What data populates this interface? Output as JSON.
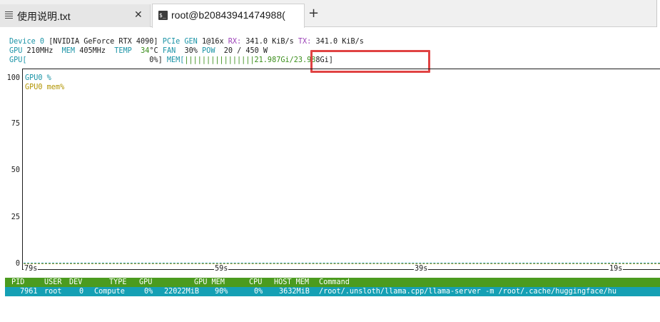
{
  "tabs": [
    {
      "label": "使用说明.txt",
      "close": "✕"
    },
    {
      "label": "root@b20843941474988(",
      "close": ""
    }
  ],
  "new_tab": "+",
  "terminal": {
    "device_line": {
      "device": "Device 0",
      "name": "[NVIDIA GeForce RTX 4090]",
      "pcie_label": "PCIe",
      "gen_label": "GEN",
      "gen_value": "1@16x",
      "rx_label": "RX:",
      "rx_value": "341.0 KiB/s",
      "tx_label": "TX:",
      "tx_value": "341.0 KiB/s"
    },
    "stats_line": {
      "gpu_label": "GPU",
      "gpu_clock": "210MHz",
      "mem_label": "MEM",
      "mem_clock": "405MHz",
      "temp_label": "TEMP",
      "temp_value": "34",
      "temp_unit": "°C",
      "fan_label": "FAN",
      "fan_value": "30%",
      "pow_label": "POW",
      "pow_value": "20 / 450 W"
    },
    "bars_line": {
      "gpu_label": "GPU[",
      "gpu_value": "0%]",
      "mem_label": "MEM[",
      "mem_bars": "||||||||||||||||",
      "mem_value_a": "21.987Gi/23.98",
      "mem_value_b": "8Gi]"
    },
    "chart_data": {
      "type": "line",
      "yticks": [
        "100",
        "75",
        "50",
        "25",
        "0"
      ],
      "ylim": [
        0,
        100
      ],
      "xticks": [
        "79s",
        "59s",
        "39s",
        "19s"
      ],
      "series": [
        {
          "name": "GPU0 %",
          "color": "#1a93a6",
          "values": [
            0,
            0,
            0,
            0
          ]
        },
        {
          "name": "GPU0 mem%",
          "color": "#b19400",
          "values": [
            0,
            0,
            0,
            0
          ]
        }
      ]
    },
    "process_table": {
      "headers": {
        "pid": "PID",
        "user": "USER",
        "dev": "DEV",
        "type": "TYPE",
        "gpu": "GPU",
        "gpu_mem": "GPU MEM",
        "cpu": "CPU",
        "host_mem": "HOST MEM",
        "command": "Command"
      },
      "rows": [
        {
          "pid": "7961",
          "user": "root",
          "dev": "0",
          "type": "Compute",
          "gpu": "0%",
          "gpu_mem": "22022MiB",
          "gpu_mem_pct": "90%",
          "cpu": "0%",
          "host_mem": "3632MiB",
          "command": "/root/.unsloth/llama.cpp/llama-server -m /root/.cache/huggingface/hu"
        }
      ]
    }
  },
  "colors": {
    "cyan": "#1a93a6",
    "green": "#3a8d1a",
    "purple": "#9a3fb6",
    "header_bg": "#4b9b1f",
    "row_bg": "#15a0b4",
    "highlight": "#e04343"
  }
}
